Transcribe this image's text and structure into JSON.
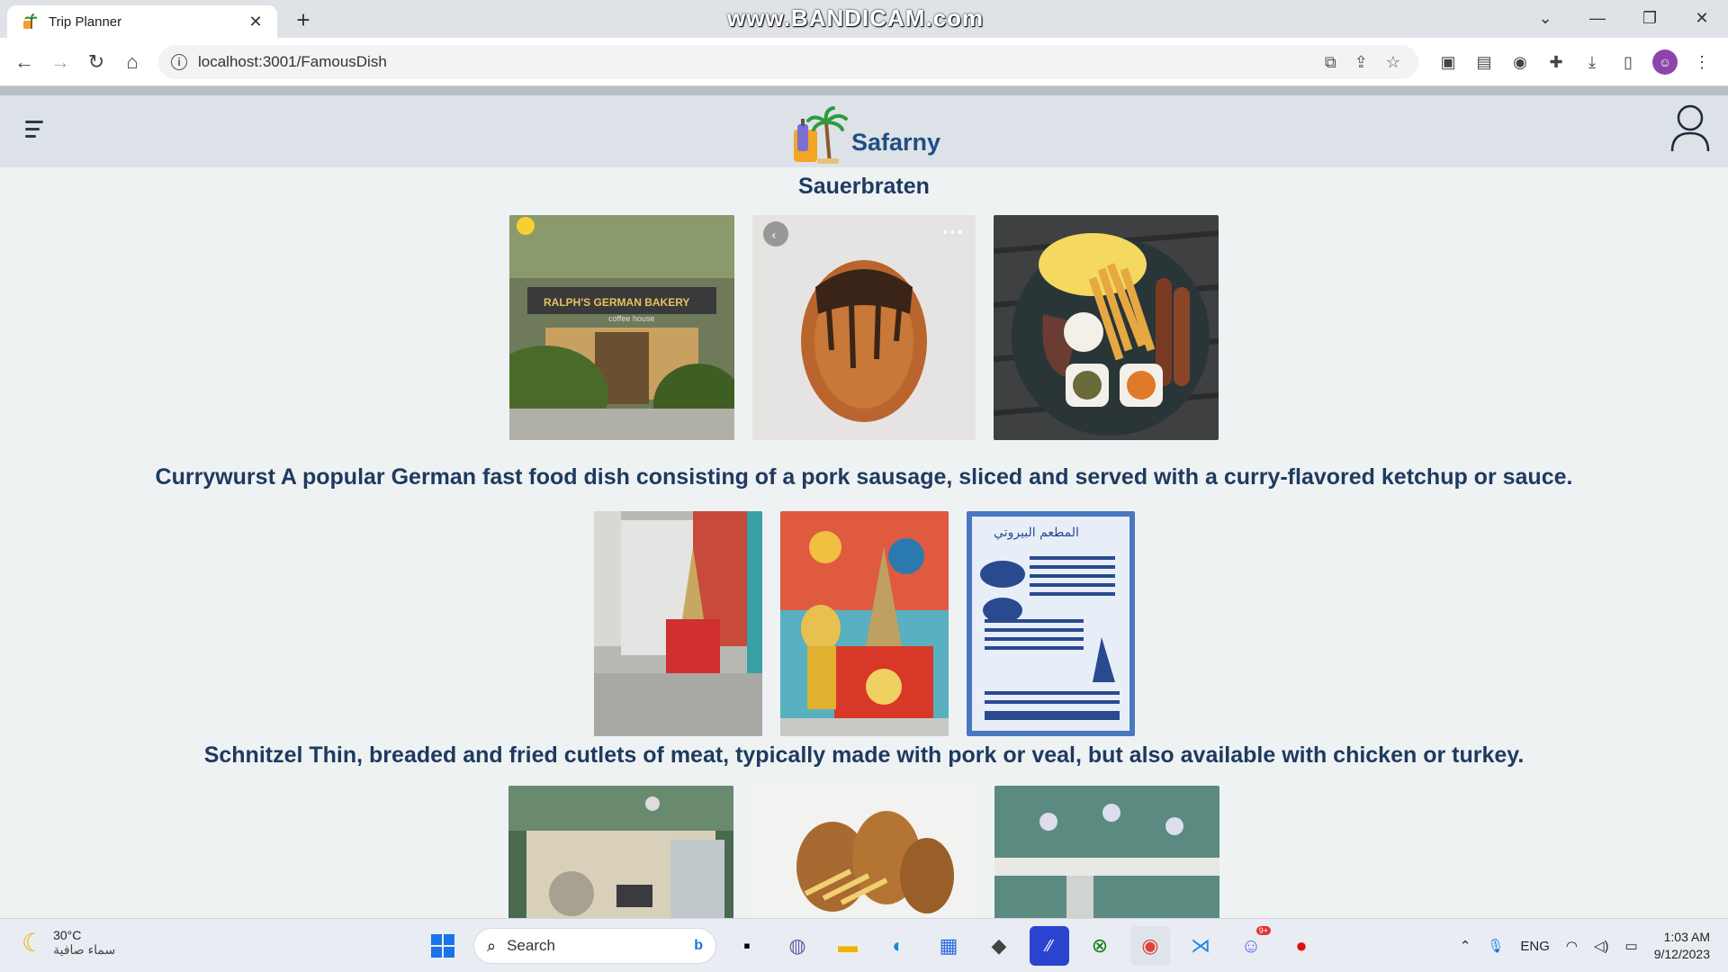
{
  "browser": {
    "tab_title": "Trip Planner",
    "new_tab": "+",
    "watermark": "www.BANDICAM.com",
    "url": "localhost:3001/FamousDish"
  },
  "app": {
    "brand": "Safarny"
  },
  "sections": [
    {
      "title": "Sauerbraten"
    },
    {
      "title": "Currywurst A popular German fast food dish consisting of a pork sausage, sliced and served with a curry-flavored ketchup or sauce."
    },
    {
      "title": "Schnitzel Thin, breaded and fried cutlets of meat, typically made with pork or veal, but also available with chicken or turkey."
    }
  ],
  "image_texts": {
    "bakery_sign": "RALPH'S GERMAN BAKERY",
    "bakery_sub": "coffee house",
    "menu_title": "المطعم البيروتي"
  },
  "taskbar": {
    "temperature": "30°C",
    "weather_desc": "سماء صافية",
    "search_label": "Search",
    "language": "ENG",
    "time": "1:03 AM",
    "date": "9/12/2023",
    "discord_badge": "9+"
  }
}
